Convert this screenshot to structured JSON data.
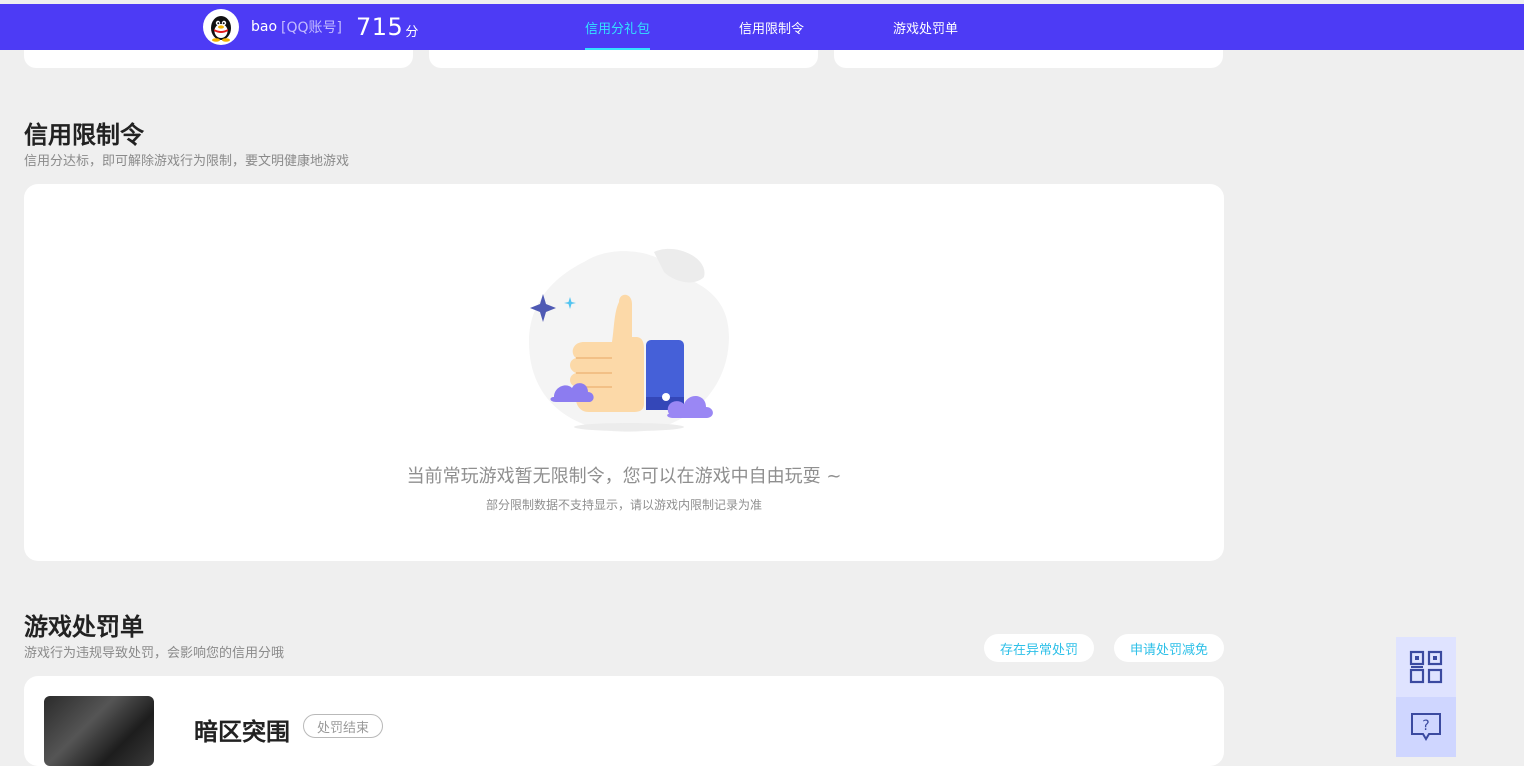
{
  "header": {
    "username": "bao",
    "account_type": "[QQ账号]",
    "score": "715",
    "score_unit": "分",
    "tabs": [
      {
        "label": "信用分礼包",
        "active": true
      },
      {
        "label": "信用限制令",
        "active": false
      },
      {
        "label": "游戏处罚单",
        "active": false
      }
    ]
  },
  "restriction": {
    "title": "信用限制令",
    "subtitle": "信用分达标，即可解除游戏行为限制，要文明健康地游戏",
    "empty_message": "当前常玩游戏暂无限制令，您可以在游戏中自由玩耍 ~",
    "empty_note": "部分限制数据不支持显示，请以游戏内限制记录为准"
  },
  "penalty": {
    "title": "游戏处罚单",
    "subtitle": "游戏行为违规导致处罚，会影响您的信用分哦",
    "buttons": {
      "abnormal": "存在异常处罚",
      "appeal": "申请处罚减免"
    },
    "items": [
      {
        "game_name": "暗区突围",
        "status": "处罚结束"
      }
    ]
  },
  "colors": {
    "nav_bg": "#4d3bf5",
    "active_tab": "#33e3ff",
    "link": "#2ec0e8",
    "page_bg": "#efefef"
  },
  "icons": {
    "avatar": "qq-penguin-icon",
    "thumbs_up": "thumbs-up-illustration",
    "qrcode": "qrcode-icon",
    "feedback": "feedback-question-icon"
  }
}
